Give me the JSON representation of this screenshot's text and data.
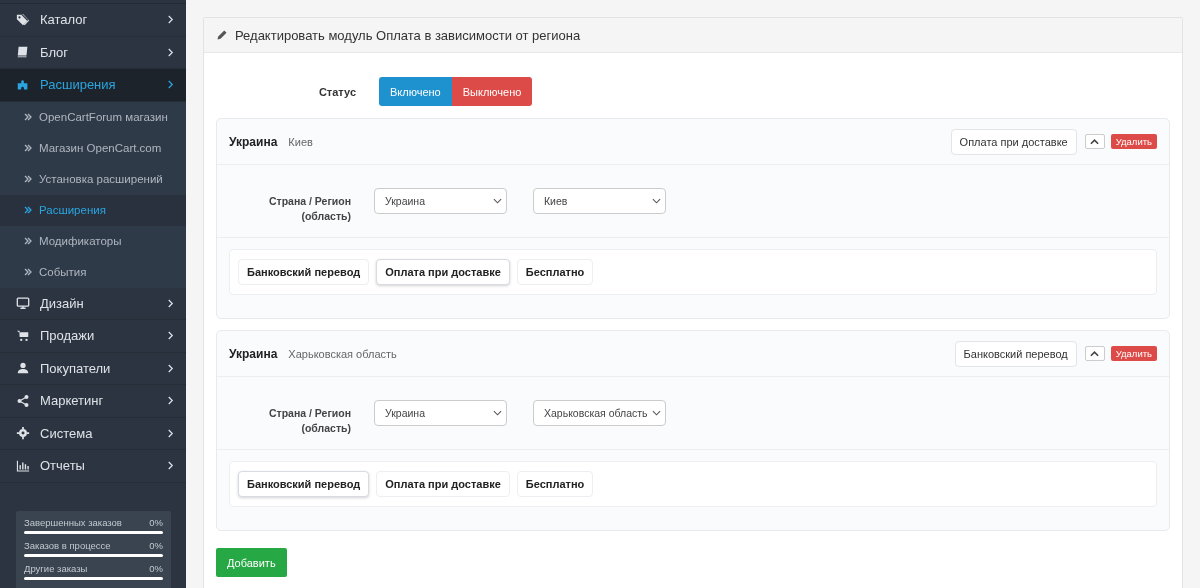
{
  "sidebar": {
    "items": [
      {
        "kind": "tag",
        "label": "Каталог",
        "selected": false
      },
      {
        "kind": "book",
        "label": "Блог",
        "selected": false
      },
      {
        "kind": "puzzle",
        "label": "Расширения",
        "selected": true,
        "children": [
          {
            "label": "OpenCartForum магазин",
            "selected": false
          },
          {
            "label": "Магазин OpenCart.com",
            "selected": false
          },
          {
            "label": "Установка расширений",
            "selected": false
          },
          {
            "label": "Расширения",
            "selected": true
          },
          {
            "label": "Модификаторы",
            "selected": false
          },
          {
            "label": "События",
            "selected": false
          }
        ]
      },
      {
        "kind": "monitor",
        "label": "Дизайн",
        "selected": false
      },
      {
        "kind": "cart",
        "label": "Продажи",
        "selected": false
      },
      {
        "kind": "user",
        "label": "Покупатели",
        "selected": false
      },
      {
        "kind": "share",
        "label": "Маркетинг",
        "selected": false
      },
      {
        "kind": "gear",
        "label": "Система",
        "selected": false
      },
      {
        "kind": "chart",
        "label": "Отчеты",
        "selected": false
      }
    ],
    "stats": [
      {
        "label": "Завершенных заказов",
        "reading": "0%",
        "level": 0
      },
      {
        "label": "Заказов в процессе",
        "reading": "0%",
        "level": 0
      },
      {
        "label": "Другие заказы",
        "reading": "0%",
        "level": 0
      }
    ]
  },
  "panel": {
    "title": "Редактировать модуль Оплата в зависимости от региона",
    "status": {
      "label": "Статус",
      "options": [
        {
          "label": "Включено",
          "color": "#1e91cf"
        },
        {
          "label": "Выключено",
          "color": "#dd4b48"
        }
      ]
    },
    "regions": [
      {
        "country": "Украина",
        "zone": "Киев",
        "method": "Оплата при доставке",
        "delete": "Удалить",
        "field_label": "Страна / Регион (область)",
        "country_value": "Украина",
        "zone_value": "Киев",
        "methods": [
          {
            "label": "Банковский перевод",
            "selected": false
          },
          {
            "label": "Оплата при доставке",
            "selected": true
          },
          {
            "label": "Бесплатно",
            "selected": false
          }
        ]
      },
      {
        "country": "Украина",
        "zone": "Харьковская область",
        "method": "Банковский перевод",
        "delete": "Удалить",
        "field_label": "Страна / Регион (область)",
        "country_value": "Украина",
        "zone_value": "Харьковская область",
        "methods": [
          {
            "label": "Банковский перевод",
            "selected": true
          },
          {
            "label": "Оплата при доставке",
            "selected": false
          },
          {
            "label": "Бесплатно",
            "selected": false
          }
        ]
      }
    ],
    "add_button": "Добавить"
  }
}
